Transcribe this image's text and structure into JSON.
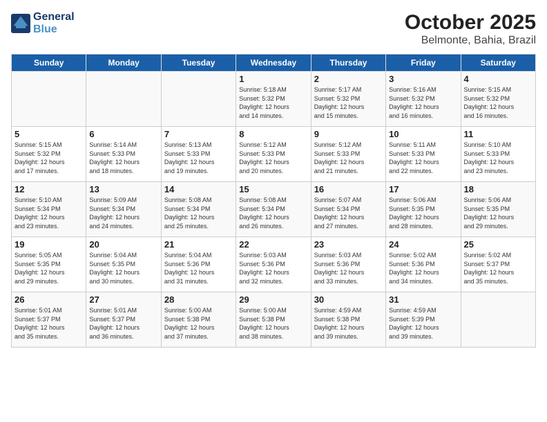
{
  "logo": {
    "line1": "General",
    "line2": "Blue"
  },
  "header": {
    "month": "October 2025",
    "location": "Belmonte, Bahia, Brazil"
  },
  "weekdays": [
    "Sunday",
    "Monday",
    "Tuesday",
    "Wednesday",
    "Thursday",
    "Friday",
    "Saturday"
  ],
  "weeks": [
    [
      {
        "day": "",
        "info": ""
      },
      {
        "day": "",
        "info": ""
      },
      {
        "day": "",
        "info": ""
      },
      {
        "day": "1",
        "info": "Sunrise: 5:18 AM\nSunset: 5:32 PM\nDaylight: 12 hours\nand 14 minutes."
      },
      {
        "day": "2",
        "info": "Sunrise: 5:17 AM\nSunset: 5:32 PM\nDaylight: 12 hours\nand 15 minutes."
      },
      {
        "day": "3",
        "info": "Sunrise: 5:16 AM\nSunset: 5:32 PM\nDaylight: 12 hours\nand 16 minutes."
      },
      {
        "day": "4",
        "info": "Sunrise: 5:15 AM\nSunset: 5:32 PM\nDaylight: 12 hours\nand 16 minutes."
      }
    ],
    [
      {
        "day": "5",
        "info": "Sunrise: 5:15 AM\nSunset: 5:32 PM\nDaylight: 12 hours\nand 17 minutes."
      },
      {
        "day": "6",
        "info": "Sunrise: 5:14 AM\nSunset: 5:33 PM\nDaylight: 12 hours\nand 18 minutes."
      },
      {
        "day": "7",
        "info": "Sunrise: 5:13 AM\nSunset: 5:33 PM\nDaylight: 12 hours\nand 19 minutes."
      },
      {
        "day": "8",
        "info": "Sunrise: 5:12 AM\nSunset: 5:33 PM\nDaylight: 12 hours\nand 20 minutes."
      },
      {
        "day": "9",
        "info": "Sunrise: 5:12 AM\nSunset: 5:33 PM\nDaylight: 12 hours\nand 21 minutes."
      },
      {
        "day": "10",
        "info": "Sunrise: 5:11 AM\nSunset: 5:33 PM\nDaylight: 12 hours\nand 22 minutes."
      },
      {
        "day": "11",
        "info": "Sunrise: 5:10 AM\nSunset: 5:33 PM\nDaylight: 12 hours\nand 23 minutes."
      }
    ],
    [
      {
        "day": "12",
        "info": "Sunrise: 5:10 AM\nSunset: 5:34 PM\nDaylight: 12 hours\nand 23 minutes."
      },
      {
        "day": "13",
        "info": "Sunrise: 5:09 AM\nSunset: 5:34 PM\nDaylight: 12 hours\nand 24 minutes."
      },
      {
        "day": "14",
        "info": "Sunrise: 5:08 AM\nSunset: 5:34 PM\nDaylight: 12 hours\nand 25 minutes."
      },
      {
        "day": "15",
        "info": "Sunrise: 5:08 AM\nSunset: 5:34 PM\nDaylight: 12 hours\nand 26 minutes."
      },
      {
        "day": "16",
        "info": "Sunrise: 5:07 AM\nSunset: 5:34 PM\nDaylight: 12 hours\nand 27 minutes."
      },
      {
        "day": "17",
        "info": "Sunrise: 5:06 AM\nSunset: 5:35 PM\nDaylight: 12 hours\nand 28 minutes."
      },
      {
        "day": "18",
        "info": "Sunrise: 5:06 AM\nSunset: 5:35 PM\nDaylight: 12 hours\nand 29 minutes."
      }
    ],
    [
      {
        "day": "19",
        "info": "Sunrise: 5:05 AM\nSunset: 5:35 PM\nDaylight: 12 hours\nand 29 minutes."
      },
      {
        "day": "20",
        "info": "Sunrise: 5:04 AM\nSunset: 5:35 PM\nDaylight: 12 hours\nand 30 minutes."
      },
      {
        "day": "21",
        "info": "Sunrise: 5:04 AM\nSunset: 5:36 PM\nDaylight: 12 hours\nand 31 minutes."
      },
      {
        "day": "22",
        "info": "Sunrise: 5:03 AM\nSunset: 5:36 PM\nDaylight: 12 hours\nand 32 minutes."
      },
      {
        "day": "23",
        "info": "Sunrise: 5:03 AM\nSunset: 5:36 PM\nDaylight: 12 hours\nand 33 minutes."
      },
      {
        "day": "24",
        "info": "Sunrise: 5:02 AM\nSunset: 5:36 PM\nDaylight: 12 hours\nand 34 minutes."
      },
      {
        "day": "25",
        "info": "Sunrise: 5:02 AM\nSunset: 5:37 PM\nDaylight: 12 hours\nand 35 minutes."
      }
    ],
    [
      {
        "day": "26",
        "info": "Sunrise: 5:01 AM\nSunset: 5:37 PM\nDaylight: 12 hours\nand 35 minutes."
      },
      {
        "day": "27",
        "info": "Sunrise: 5:01 AM\nSunset: 5:37 PM\nDaylight: 12 hours\nand 36 minutes."
      },
      {
        "day": "28",
        "info": "Sunrise: 5:00 AM\nSunset: 5:38 PM\nDaylight: 12 hours\nand 37 minutes."
      },
      {
        "day": "29",
        "info": "Sunrise: 5:00 AM\nSunset: 5:38 PM\nDaylight: 12 hours\nand 38 minutes."
      },
      {
        "day": "30",
        "info": "Sunrise: 4:59 AM\nSunset: 5:38 PM\nDaylight: 12 hours\nand 39 minutes."
      },
      {
        "day": "31",
        "info": "Sunrise: 4:59 AM\nSunset: 5:39 PM\nDaylight: 12 hours\nand 39 minutes."
      },
      {
        "day": "",
        "info": ""
      }
    ]
  ]
}
